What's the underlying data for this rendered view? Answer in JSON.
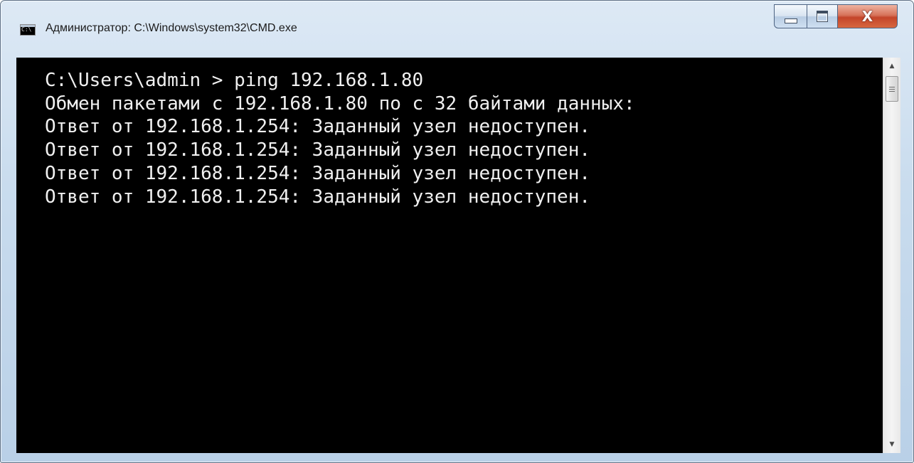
{
  "window": {
    "title": "Администратор: C:\\Windows\\system32\\CMD.exe",
    "app_icon_text": "C:\\",
    "buttons": {
      "minimize_icon": "minimize-icon",
      "maximize_icon": "maximize-icon",
      "close_icon": "close-icon",
      "close_glyph": "X"
    }
  },
  "console": {
    "lines": [
      "C:\\Users\\admin > ping 192.168.1.80",
      "Обмен пакетами с 192.168.1.80 по с 32 байтами данных:",
      "Ответ от 192.168.1.254: Заданный узел недоступен.",
      "Ответ от 192.168.1.254: Заданный узел недоступен.",
      "Ответ от 192.168.1.254: Заданный узел недоступен.",
      "Ответ от 192.168.1.254: Заданный узел недоступен."
    ],
    "background": "#000000",
    "foreground": "#f0f0f0"
  },
  "scrollbar": {
    "up_glyph": "▲",
    "down_glyph": "▼"
  }
}
